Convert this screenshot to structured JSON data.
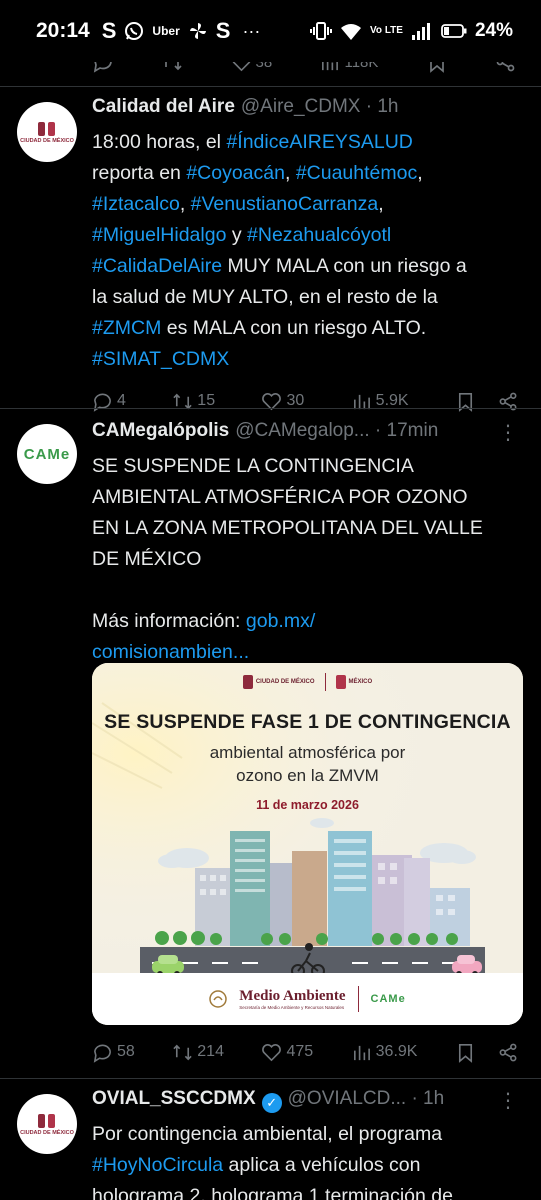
{
  "status_bar": {
    "time": "20:14",
    "apps": [
      "S",
      "whatsapp",
      "Uber",
      "pinwheel",
      "S",
      "···"
    ],
    "network": "Vo LTE",
    "battery": "24%"
  },
  "prev_tweet": {
    "likes": "38",
    "views": "118K"
  },
  "tweets": [
    {
      "name": "Calidad del Aire",
      "handle": "@Aire_CDMX · 1h",
      "avatar_text": "CIUDAD DE MÉXICO",
      "lines": [
        [
          {
            "t": "18:00 horas, el "
          },
          {
            "t": "#ÍndiceAIREYSALUD",
            "tag": true
          }
        ],
        [
          {
            "t": "reporta en "
          },
          {
            "t": "#Coyoacán",
            "tag": true
          },
          {
            "t": ", "
          },
          {
            "t": "#Cuauhtémoc",
            "tag": true
          },
          {
            "t": ","
          }
        ],
        [
          {
            "t": "#Iztacalco",
            "tag": true
          },
          {
            "t": ", "
          },
          {
            "t": "#VenustianoCarranza",
            "tag": true
          },
          {
            "t": ","
          }
        ],
        [
          {
            "t": "#MiguelHidalgo",
            "tag": true
          },
          {
            "t": " y "
          },
          {
            "t": "#Nezahualcóyotl",
            "tag": true
          }
        ],
        [
          {
            "t": "#CalidaDelAire",
            "tag": true
          },
          {
            "t": " MUY MALA con un riesgo a"
          }
        ],
        [
          {
            "t": "la salud de MUY ALTO, en el resto de la"
          }
        ],
        [
          {
            "t": "#ZMCM",
            "tag": true
          },
          {
            "t": " es MALA con un riesgo ALTO."
          }
        ],
        [
          {
            "t": "#SIMAT_CDMX",
            "tag": true
          }
        ]
      ],
      "replies": "4",
      "retweets": "15",
      "likes": "30",
      "views": "5.9K"
    },
    {
      "name": "CAMegalópolis",
      "handle": "@CAMegalop... · 17min",
      "avatar_text": "CAMe",
      "lines": [
        [
          {
            "t": "SE SUSPENDE LA CONTINGENCIA"
          }
        ],
        [
          {
            "t": "AMBIENTAL ATMOSFÉRICA POR OZONO"
          }
        ],
        [
          {
            "t": "EN LA ZONA METROPOLITANA DEL VALLE"
          }
        ],
        [
          {
            "t": "DE MÉXICO"
          }
        ],
        [
          {
            "t": ""
          }
        ],
        [
          {
            "t": "Más información: "
          },
          {
            "t": "gob.mx/",
            "tag": true
          }
        ],
        [
          {
            "t": "comisionambien...",
            "tag": true
          }
        ]
      ],
      "card": {
        "logos": [
          "CIUDAD DE MÉXICO",
          "MÉXICO"
        ],
        "title": "SE SUSPENDE FASE 1 DE CONTINGENCIA",
        "subtitle_1": "ambiental atmosférica por",
        "subtitle_2": "ozono en la ZMVM",
        "date": "11 de marzo 2026",
        "footer_label": "Medio Ambiente",
        "footer_sub": "Secretaría de Medio Ambiente y Recursos Naturales",
        "footer_came": "CAMe"
      },
      "replies": "58",
      "retweets": "214",
      "likes": "475",
      "views": "36.9K"
    },
    {
      "name": "OVIAL_SSCCDMX",
      "handle": "@OVIALCD... · 1h",
      "avatar_text": "CIUDAD DE MÉXICO",
      "lines": [
        [
          {
            "t": "Por contingencia ambiental, el programa"
          }
        ],
        [
          {
            "t": "#HoyNoCircula",
            "tag": true
          },
          {
            "t": " aplica a vehículos con"
          }
        ],
        [
          {
            "t": "holograma 2, holograma 1 terminación de"
          }
        ]
      ]
    }
  ],
  "colors": {
    "background": "#000000",
    "text": "#e7e9ea",
    "muted": "#71767b",
    "link": "#1d9bf0",
    "divider": "#2f3336"
  }
}
